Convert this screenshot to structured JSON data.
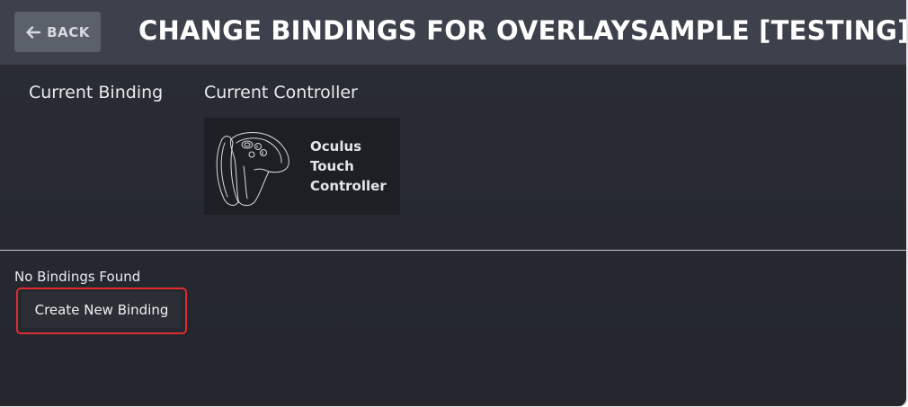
{
  "header": {
    "back_label": "BACK",
    "back_icon": "arrow-left-icon",
    "title": "CHANGE BINDINGS FOR OVERLAYSAMPLE [TESTING]"
  },
  "current": {
    "binding_label": "Current Binding",
    "controller_label": "Current Controller",
    "controller": {
      "name": "Oculus Touch Controller",
      "icon": "oculus-touch-controller-icon"
    }
  },
  "bindings": {
    "status": "No Bindings Found",
    "create_label": "Create New Binding"
  },
  "colors": {
    "header_bg": "#3c414b",
    "page_bg": "#262930",
    "back_button_bg": "#5b616b",
    "highlight": "#e02c2c"
  }
}
